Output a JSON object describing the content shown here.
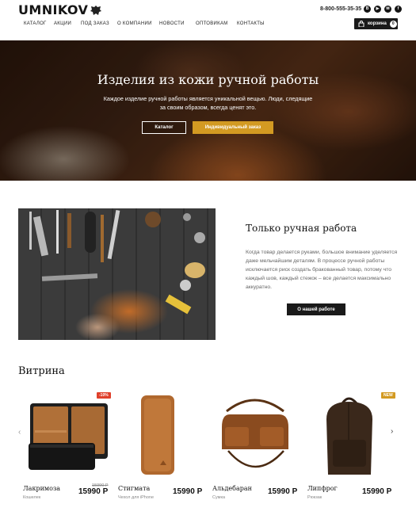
{
  "header": {
    "logo": "UMNIKOV",
    "phone": "8-800-555-35-35",
    "socials": [
      "vk-icon",
      "youtube-icon",
      "mail-icon",
      "facebook-icon"
    ],
    "nav": [
      "КАТАЛОГ",
      "АКЦИИ",
      "ПОД ЗАКАЗ",
      "О КОМПАНИИ",
      "НОВОСТИ",
      "ОПТОВИКАМ",
      "КОНТАКТЫ"
    ],
    "cart_label": "корзина",
    "cart_count": "0"
  },
  "hero": {
    "title": "Изделия из кожи ручной работы",
    "text": "Каждое изделие ручной работы является уникальной вещью. Люди, следящие за своим образом, всегда ценят это.",
    "btn_catalog": "Каталог",
    "btn_custom": "Индивидуальный заказ"
  },
  "handmade": {
    "title": "Только ручная работа",
    "text": "Когда товар делается руками, большое внимание уделяется даже мельчайшим деталям. В процессе ручной работы исключается риск создать бракованный товар, потому что каждый шов, каждый стежок – все делается максимально аккуратно.",
    "button": "О нашей работе"
  },
  "showcase": {
    "title": "Витрина",
    "products": [
      {
        "name": "Лакримоза",
        "category": "Кошелек",
        "price": "15990 Р",
        "old_price": "15990 Р",
        "badge": "-10%",
        "badge_color": "#e0402b"
      },
      {
        "name": "Стигмата",
        "category": "Чехол для iPhone",
        "price": "15990 Р",
        "old_price": "",
        "badge": "",
        "badge_color": ""
      },
      {
        "name": "Альдебаран",
        "category": "Сумка",
        "price": "15990 Р",
        "old_price": "",
        "badge": "",
        "badge_color": ""
      },
      {
        "name": "Липфрог",
        "category": "Рюкзак",
        "price": "15990 Р",
        "old_price": "",
        "badge": "NEW",
        "badge_color": "#d39a22"
      }
    ]
  },
  "colors": {
    "accent": "#d39a22",
    "dark": "#1a1a1a",
    "sale": "#e0402b"
  }
}
